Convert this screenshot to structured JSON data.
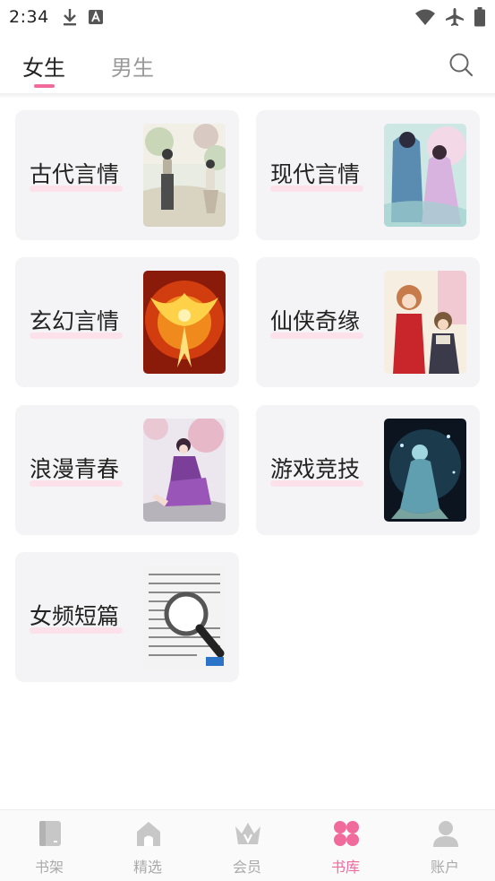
{
  "status_bar": {
    "time": "2:34",
    "icons": [
      "download-icon",
      "a-badge-icon",
      "wifi-icon",
      "airplane-icon",
      "battery-icon"
    ]
  },
  "top_tabs": {
    "tabs": [
      {
        "label": "女生",
        "active": true
      },
      {
        "label": "男生",
        "active": false
      }
    ],
    "search_icon": "search-icon",
    "accent_color": "#f06b9c"
  },
  "categories": [
    {
      "label": "古代言情",
      "cover": "ancient-romance-cover"
    },
    {
      "label": "现代言情",
      "cover": "modern-romance-cover"
    },
    {
      "label": "玄幻言情",
      "cover": "fantasy-romance-phoenix-cover"
    },
    {
      "label": "仙侠奇缘",
      "cover": "xianxia-cover"
    },
    {
      "label": "浪漫青春",
      "cover": "romance-youth-cover"
    },
    {
      "label": "游戏竞技",
      "cover": "game-esports-cover"
    },
    {
      "label": "女频短篇",
      "cover": "short-story-newspaper-cover"
    }
  ],
  "bottom_nav": {
    "items": [
      {
        "label": "书架",
        "icon": "bookshelf-icon",
        "active": false
      },
      {
        "label": "精选",
        "icon": "featured-home-icon",
        "active": false
      },
      {
        "label": "会员",
        "icon": "vip-crown-icon",
        "active": false
      },
      {
        "label": "书库",
        "icon": "library-grid-icon",
        "active": true
      },
      {
        "label": "账户",
        "icon": "account-user-icon",
        "active": false
      }
    ],
    "active_color": "#f06b9c",
    "inactive_color": "#aaaaaa"
  }
}
